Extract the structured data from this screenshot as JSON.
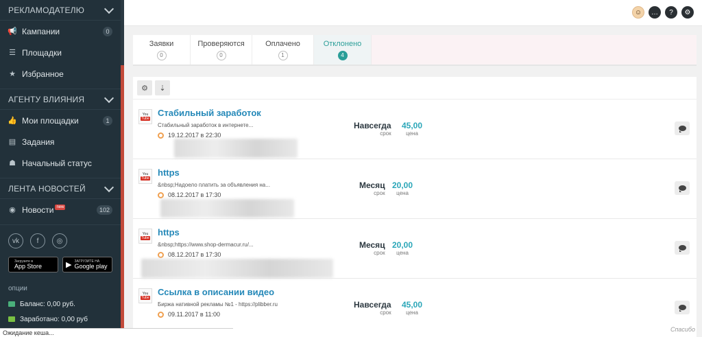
{
  "sidebar": {
    "sections": [
      {
        "title": "РЕКЛАМОДАТЕЛЮ",
        "items": [
          {
            "label": "Кампании",
            "icon": "megaphone-icon",
            "count": "0"
          },
          {
            "label": "Площадки",
            "icon": "list-icon",
            "count": ""
          },
          {
            "label": "Избранное",
            "icon": "star-icon",
            "count": ""
          }
        ]
      },
      {
        "title": "АГЕНТУ ВЛИЯНИЯ",
        "items": [
          {
            "label": "Мои площадки",
            "icon": "thumbs-up-icon",
            "count": "1"
          },
          {
            "label": "Задания",
            "icon": "document-icon",
            "count": ""
          },
          {
            "label": "Начальный статус",
            "icon": "user-icon",
            "count": ""
          }
        ]
      },
      {
        "title": "ЛЕНТА НОВОСТЕЙ",
        "items": [
          {
            "label": "Новости",
            "icon": "news-icon",
            "count": "102",
            "badge": "new"
          }
        ]
      }
    ],
    "social": [
      "vk-icon",
      "facebook-icon",
      "instagram-icon"
    ],
    "stores": [
      {
        "small": "Загрузите в",
        "big": "App Store",
        "icon": "apple-icon"
      },
      {
        "small": "ЗАГРУЗИТЕ НА",
        "big": "Google play",
        "icon": "google-play-icon"
      }
    ],
    "options_label": "опции",
    "balance": "Баланс: 0,00 руб.",
    "earned": "Заработано: 0,00 руб"
  },
  "tabs": [
    {
      "label": "Заявки",
      "count": "0"
    },
    {
      "label": "Проверяются",
      "count": "0"
    },
    {
      "label": "Оплачено",
      "count": "1"
    },
    {
      "label": "Отклонено",
      "count": "4",
      "active": true
    }
  ],
  "list": [
    {
      "title": "Стабильный заработок",
      "desc": "Стабильный заработок в интернете...",
      "date": "19.12.2017 в 22:30",
      "term": "Навсегда",
      "term_label": "срок",
      "price": "45,00",
      "price_label": "цена"
    },
    {
      "title": "https",
      "desc": "&nbsp;Надоело платить за объявления на...",
      "date": "08.12.2017 в 17:30",
      "term": "Месяц",
      "term_label": "срок",
      "price": "20,00",
      "price_label": "цена"
    },
    {
      "title": "https",
      "desc": "&nbsp;https://www.shop-dermacur.ru/...",
      "date": "08.12.2017 в 17:30",
      "term": "Месяц",
      "term_label": "срок",
      "price": "20,00",
      "price_label": "цена"
    },
    {
      "title": "Ссылка в описании видео",
      "desc": "Биржа нативной рекламы №1 - https://plibber.ru",
      "date": "09.11.2017 в 11:00",
      "term": "Навсегда",
      "term_label": "срок",
      "price": "45,00",
      "price_label": "цена"
    }
  ],
  "statusbar": "Ожидание кеша...",
  "watermark": "Спасибо",
  "colors": {
    "accent": "#2a9e98",
    "link": "#2488b8",
    "price": "#2aa6b8",
    "sidebar": "#22313a"
  }
}
